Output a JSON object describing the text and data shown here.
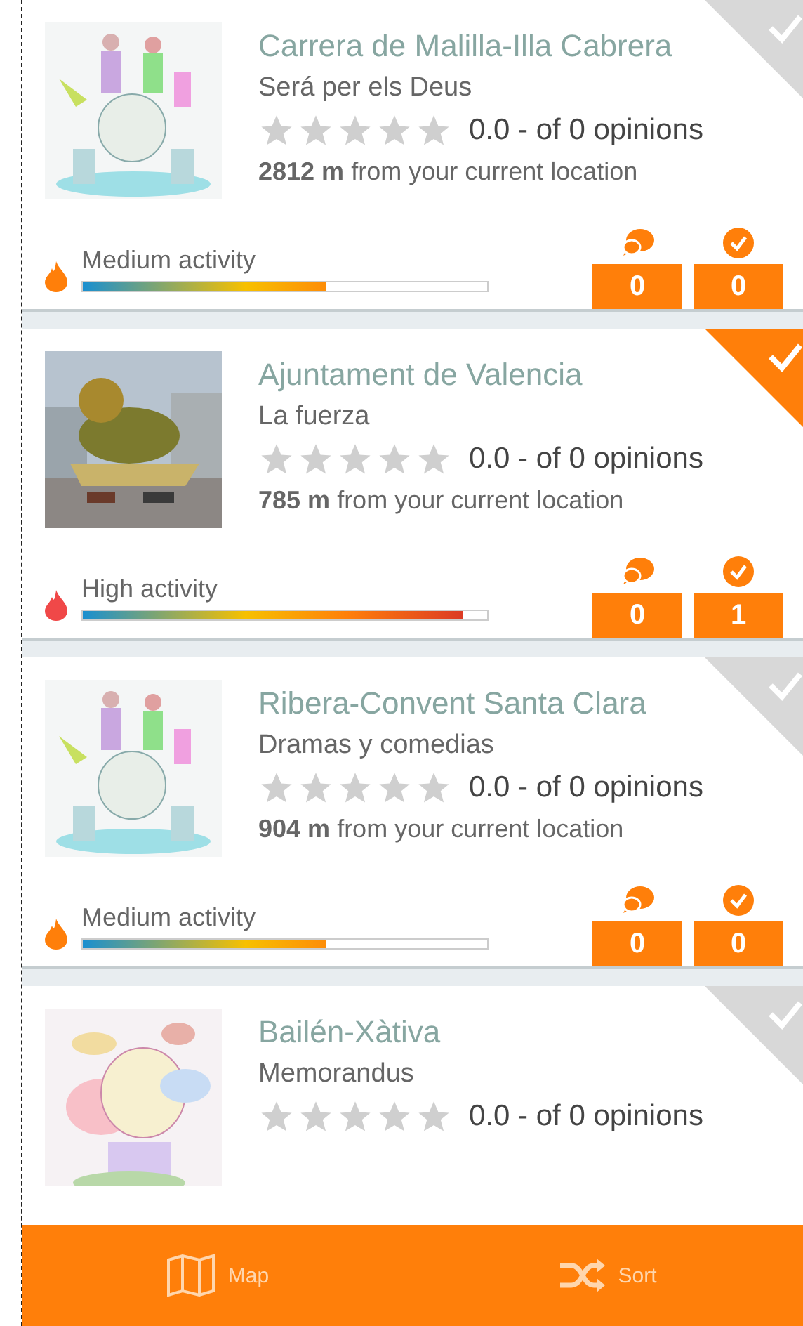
{
  "items": [
    {
      "title": "Carrera de Malilla-Illa Cabrera",
      "subtitle": "Será per els Deus",
      "stars": 0,
      "rating": "0.0 - of 0 opinions",
      "distance": "2812 m",
      "distance_label": "from your current location",
      "activity": {
        "label": "Medium activity",
        "level": 0.6,
        "kind": "medium"
      },
      "comments": "0",
      "checkins": "0",
      "visited": false
    },
    {
      "title": "Ajuntament de Valencia",
      "subtitle": "La fuerza",
      "stars": 0,
      "rating": "0.0 - of 0 opinions",
      "distance": "785 m",
      "distance_label": "from your current location",
      "activity": {
        "label": "High activity",
        "level": 0.94,
        "kind": "high"
      },
      "comments": "0",
      "checkins": "1",
      "visited": true
    },
    {
      "title": "Ribera-Convent Santa Clara",
      "subtitle": "Dramas y comedias",
      "stars": 0,
      "rating": "0.0 - of 0 opinions",
      "distance": "904 m",
      "distance_label": "from your current location",
      "activity": {
        "label": "Medium activity",
        "level": 0.6,
        "kind": "medium"
      },
      "comments": "0",
      "checkins": "0",
      "visited": false
    },
    {
      "title": "Bailén-Xàtiva",
      "subtitle": "Memorandus",
      "stars": 0,
      "rating": "0.0 - of 0 opinions",
      "visited": false
    }
  ],
  "bottom_bar": [
    {
      "label": "Map",
      "kind": "map"
    },
    {
      "label": "Sort",
      "kind": "sort"
    }
  ]
}
